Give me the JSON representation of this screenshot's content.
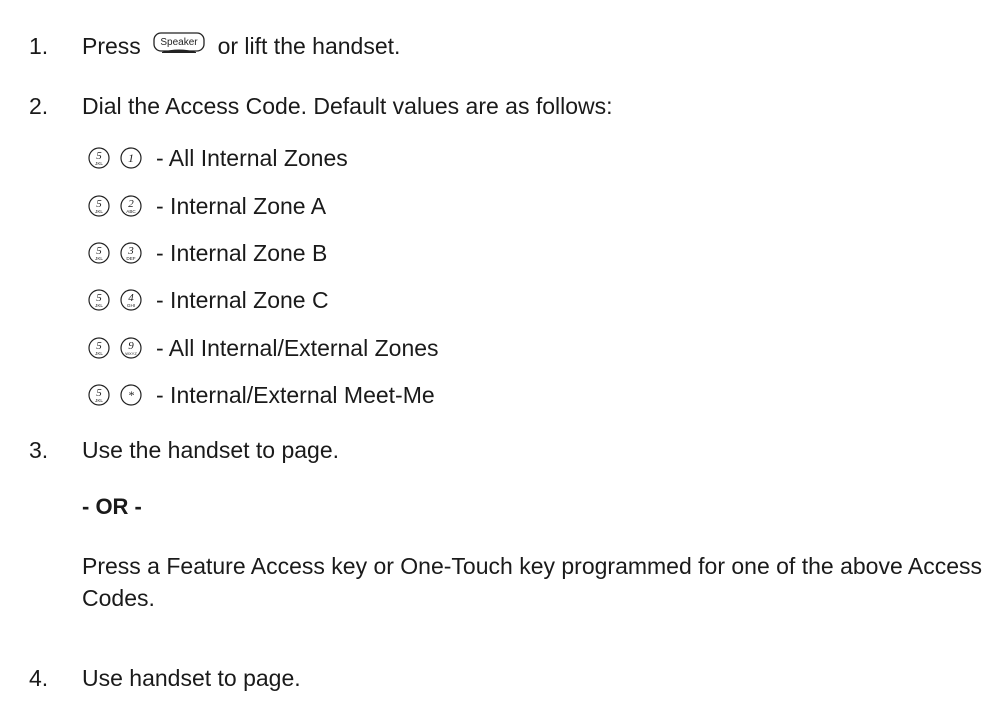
{
  "steps": [
    {
      "number": "1.",
      "before_key": "Press",
      "key_icon": "speaker-key",
      "key_text": "Speaker",
      "after_key": "or lift the handset."
    },
    {
      "number": "2.",
      "text": "Dial the Access Code. Default values are as follows:",
      "codes": [
        {
          "keys": [
            {
              "digit": "5",
              "letters": "JKL"
            },
            {
              "digit": "1",
              "letters": ""
            }
          ],
          "label": "- All Internal Zones"
        },
        {
          "keys": [
            {
              "digit": "5",
              "letters": "JKL"
            },
            {
              "digit": "2",
              "letters": "ABC"
            }
          ],
          "label": "- Internal Zone A"
        },
        {
          "keys": [
            {
              "digit": "5",
              "letters": "JKL"
            },
            {
              "digit": "3",
              "letters": "DEF"
            }
          ],
          "label": "- Internal Zone B"
        },
        {
          "keys": [
            {
              "digit": "5",
              "letters": "JKL"
            },
            {
              "digit": "4",
              "letters": "GHI"
            }
          ],
          "label": "- Internal Zone C"
        },
        {
          "keys": [
            {
              "digit": "5",
              "letters": "JKL"
            },
            {
              "digit": "9",
              "letters": "WXYZ"
            }
          ],
          "label": "- All Internal/External Zones"
        },
        {
          "keys": [
            {
              "digit": "5",
              "letters": "JKL"
            },
            {
              "digit": "*",
              "letters": ""
            }
          ],
          "label": "- Internal/External Meet-Me"
        }
      ]
    },
    {
      "number": "3.",
      "text": "Use the handset to page.",
      "or_text": "- OR -",
      "alt_text": "Press a Feature Access key or One-Touch key programmed for one of the above Access Codes."
    },
    {
      "number": "4.",
      "text": "Use handset to page."
    }
  ]
}
